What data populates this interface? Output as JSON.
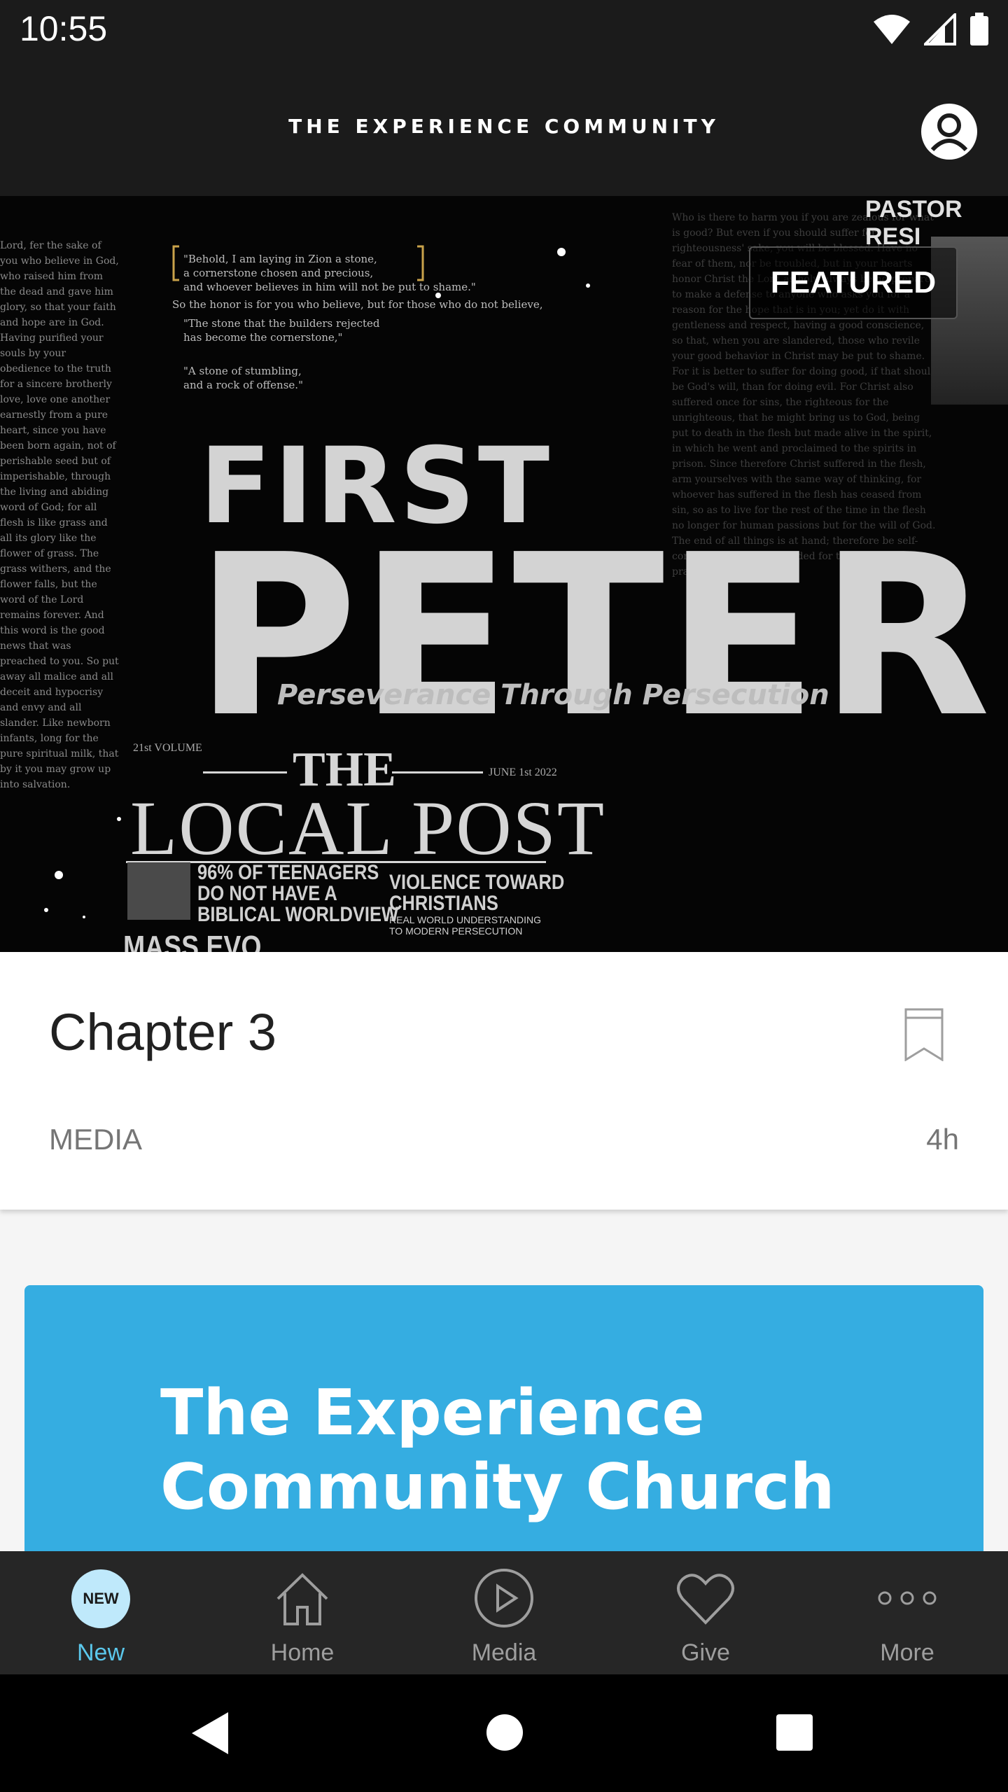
{
  "status_bar": {
    "time": "10:55",
    "icons": [
      "wifi-icon",
      "signal-icon",
      "battery-icon"
    ]
  },
  "header": {
    "title": "THE EXPERIENCE COMMUNITY",
    "profile_icon": "profile-icon"
  },
  "hero": {
    "badge": "FEATURED",
    "title_line1": "FIRST",
    "title_line2": "PETER",
    "subtitle": "Perseverance Through Persecution",
    "pastor_tag": "PASTOR RESI",
    "newspaper": {
      "the": "THE",
      "name": "LOCAL POST",
      "volume": "21st VOLUME",
      "date": "JUNE 1st 2022",
      "headline_left": "96% OF TEENAGERS\nDO NOT HAVE A\nBIBLICAL WORLDVIEW",
      "headline_right": "VIOLENCE TOWARD\nCHRISTIANS",
      "subhead_right": "REAL WORLD UNDERSTANDING\nTO MODERN PERSECUTION",
      "bottom_cut": "MASS EVO"
    },
    "verses": {
      "v1": "\"Behold, I am laying in Zion a stone,\n a cornerstone chosen and precious,\n and whoever believes in him will not be put to shame.\"",
      "v2": "So the honor is for you who believe, but for those who do not believe,",
      "v3": "\"The stone that the builders rejected\n has become the cornerstone,\"",
      "v4": "\"A stone of stumbling,\n and a rock of offense.\""
    }
  },
  "item": {
    "title": "Chapter 3",
    "category": "MEDIA",
    "age": "4h",
    "bookmark_icon": "bookmark-icon"
  },
  "card": {
    "title": "The Experience\nCommunity Church",
    "color": "#35ade1"
  },
  "bottom_nav": {
    "items": [
      {
        "label": "New",
        "badge": "NEW",
        "icon": "new-icon",
        "active": true
      },
      {
        "label": "Home",
        "icon": "home-icon",
        "active": false
      },
      {
        "label": "Media",
        "icon": "play-icon",
        "active": false
      },
      {
        "label": "Give",
        "icon": "heart-icon",
        "active": false
      },
      {
        "label": "More",
        "icon": "more-icon",
        "active": false
      }
    ],
    "active_color": "#5bc8ec"
  },
  "system_nav": [
    "back-icon",
    "home-circle-icon",
    "recents-icon"
  ]
}
